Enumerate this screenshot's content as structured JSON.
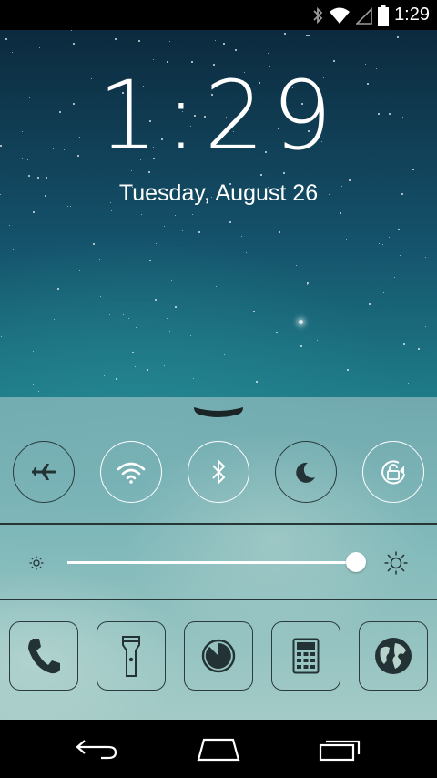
{
  "status_bar": {
    "time": "1:29",
    "icons": [
      "bluetooth-icon",
      "wifi-icon",
      "signal-icon",
      "battery-icon"
    ]
  },
  "lock_screen": {
    "time": "1:29",
    "date": "Tuesday, August 26"
  },
  "control_center": {
    "toggles": [
      {
        "name": "airplane-mode",
        "icon": "airplane-icon",
        "active": false
      },
      {
        "name": "wifi",
        "icon": "wifi-icon",
        "active": true
      },
      {
        "name": "bluetooth",
        "icon": "bluetooth-icon",
        "active": true
      },
      {
        "name": "do-not-disturb",
        "icon": "moon-icon",
        "active": false
      },
      {
        "name": "rotation-lock",
        "icon": "rotation-lock-icon",
        "active": true
      }
    ],
    "brightness": {
      "level": 0.99
    },
    "shortcuts": [
      {
        "name": "phone",
        "icon": "phone-icon"
      },
      {
        "name": "flashlight",
        "icon": "flashlight-icon"
      },
      {
        "name": "timer",
        "icon": "timer-icon"
      },
      {
        "name": "calculator",
        "icon": "calculator-icon"
      },
      {
        "name": "browser",
        "icon": "globe-icon"
      }
    ]
  },
  "colors": {
    "sky_top": "#0c2a3e",
    "sky_bottom": "#7ab9b3",
    "icon_dark": "#233234",
    "accent_white": "#ffffff"
  },
  "nav_bar": {
    "buttons": [
      "back",
      "home",
      "recents"
    ]
  }
}
